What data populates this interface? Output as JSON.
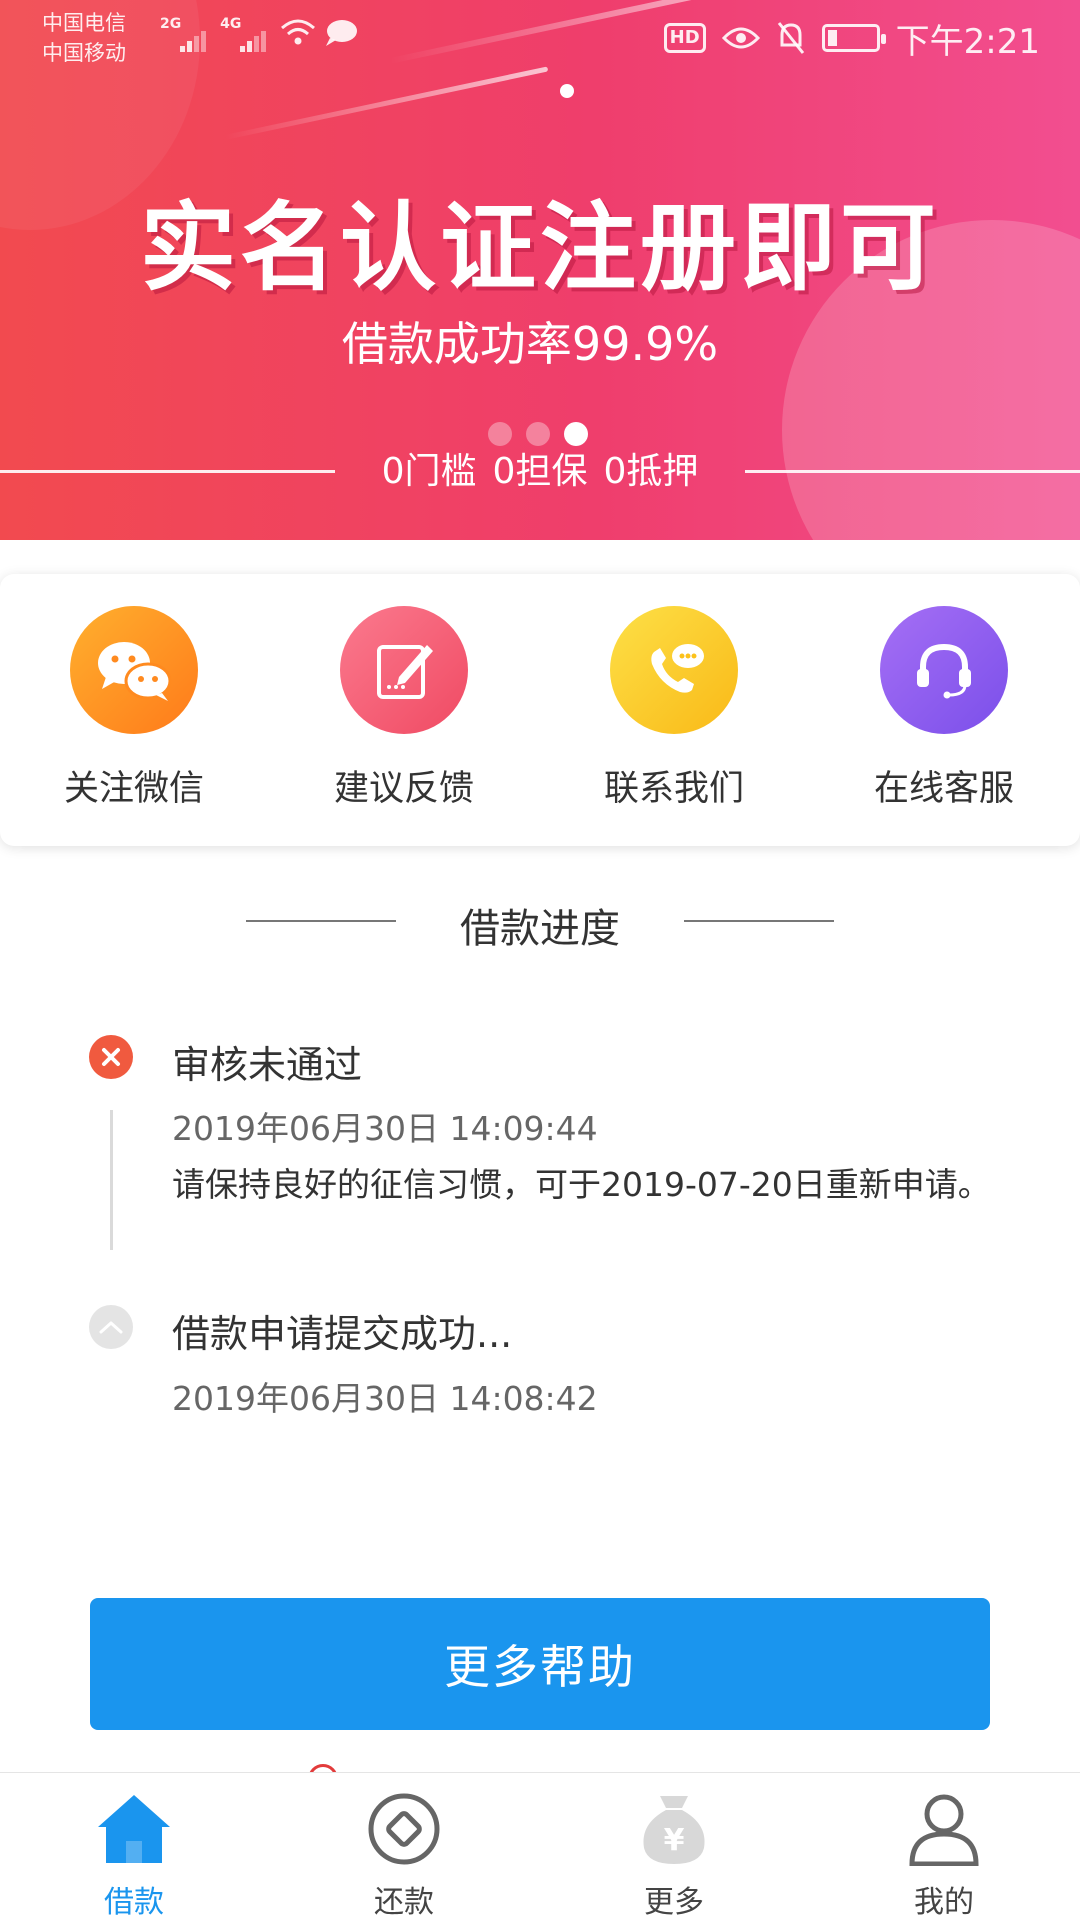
{
  "status_bar": {
    "carrier_1": "中国电信",
    "carrier_2": "中国移动",
    "network_1": "2G",
    "network_2": "4G",
    "hd_badge": "HD",
    "time": "下午2:21",
    "battery_level": 0.2
  },
  "banner": {
    "title": "实名认证注册即可",
    "subtitle": "借款成功率99.9%",
    "tags": [
      "0门槛",
      "0担保",
      "0抵押"
    ],
    "carousel": {
      "total": 3,
      "active_index": 2
    },
    "gradient": [
      "#f24a4f",
      "#f24e90"
    ]
  },
  "quick_actions": [
    {
      "label": "关注微信",
      "icon": "wechat-icon",
      "color": "#ff8a1f"
    },
    {
      "label": "建议反馈",
      "icon": "edit-feedback-icon",
      "color": "#f5576c"
    },
    {
      "label": "联系我们",
      "icon": "phone-chat-icon",
      "color": "#fcc21b"
    },
    {
      "label": "在线客服",
      "icon": "headset-icon",
      "color": "#8d5cf0"
    }
  ],
  "progress": {
    "section_title": "借款进度",
    "steps": [
      {
        "title": "审核未通过",
        "time": "2019年06月30日 14:09:44",
        "description": "请保持良好的征信习惯，可于2019-07-20日重新申请。",
        "status_icon": "close-circle-icon",
        "status_color": "#f05a3f"
      },
      {
        "title": "借款申请提交成功...",
        "time": "2019年06月30日 14:08:42",
        "status_icon": "chevron-up-circle-icon",
        "status_color": "#e4e4e4"
      }
    ]
  },
  "help_button": {
    "label": "更多帮助",
    "color": "#1a95ee"
  },
  "bottom_nav": {
    "items": [
      {
        "label": "借款",
        "icon": "home-icon",
        "active": true
      },
      {
        "label": "还款",
        "icon": "repay-icon",
        "active": false
      },
      {
        "label": "更多",
        "icon": "money-bag-icon",
        "active": false
      },
      {
        "label": "我的",
        "icon": "user-icon",
        "active": false
      }
    ],
    "active_color": "#1a95ee"
  }
}
